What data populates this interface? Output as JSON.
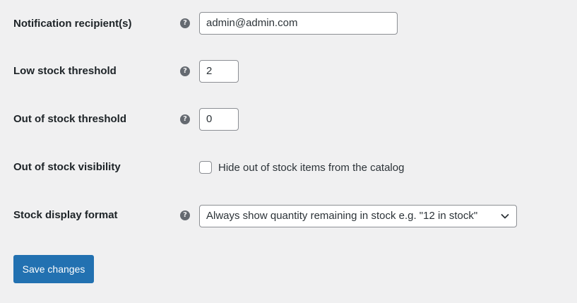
{
  "settings": [
    {
      "label": "Notification recipient(s)",
      "type": "text",
      "value": "admin@admin.com",
      "help_icon": "question-circle-icon"
    },
    {
      "label": "Low stock threshold",
      "type": "number",
      "value": "2",
      "help_icon": "question-circle-icon"
    },
    {
      "label": "Out of stock threshold",
      "type": "number",
      "value": "0",
      "help_icon": "question-circle-icon"
    },
    {
      "label": "Out of stock visibility",
      "type": "checkbox",
      "checked": false,
      "checkbox_label": "Hide out of stock items from the catalog"
    },
    {
      "label": "Stock display format",
      "type": "select",
      "selected": "Always show quantity remaining in stock e.g. \"12 in stock\"",
      "help_icon": "question-circle-icon",
      "dropdown_icon": "chevron-down-icon"
    }
  ],
  "help_glyph": "?",
  "save_button": {
    "label": "Save changes"
  },
  "colors": {
    "background": "#f0f0f1",
    "primary_button": "#2271b1",
    "help_icon": "#646970",
    "text": "#1d2327"
  }
}
